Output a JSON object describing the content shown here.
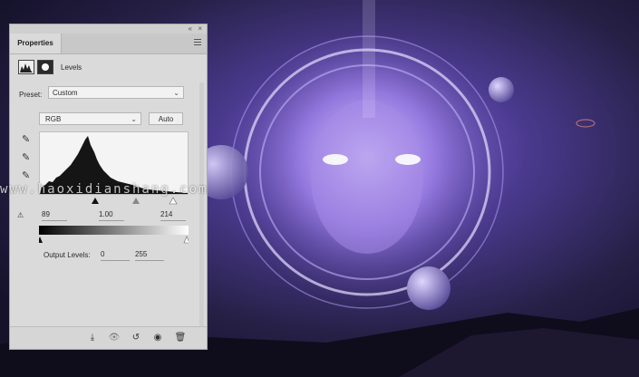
{
  "panel": {
    "tab_label": "Properties",
    "collapse_glyph": "«",
    "close_glyph": "×",
    "adjustment_title": "Levels",
    "preset_label": "Preset:",
    "preset_value": "Custom",
    "channel_value": "RGB",
    "auto_label": "Auto",
    "input_levels": {
      "black": "89",
      "gamma": "1.00",
      "white": "214"
    },
    "output_label": "Output Levels:",
    "output_levels": {
      "black": "0",
      "white": "255"
    },
    "chevron": "⌄"
  },
  "icons": {
    "eyedropper": "✎",
    "clip": "⚠",
    "mask_clip": "⤓",
    "view_previous": "👁",
    "reset": "↺",
    "visibility": "◉",
    "trash": "🗑"
  },
  "watermark": "www.haoxidianshang.com",
  "colors": {
    "panel_bg": "#dadada",
    "sky_dark": "#1a1530",
    "glow": "#b9a6ff"
  }
}
